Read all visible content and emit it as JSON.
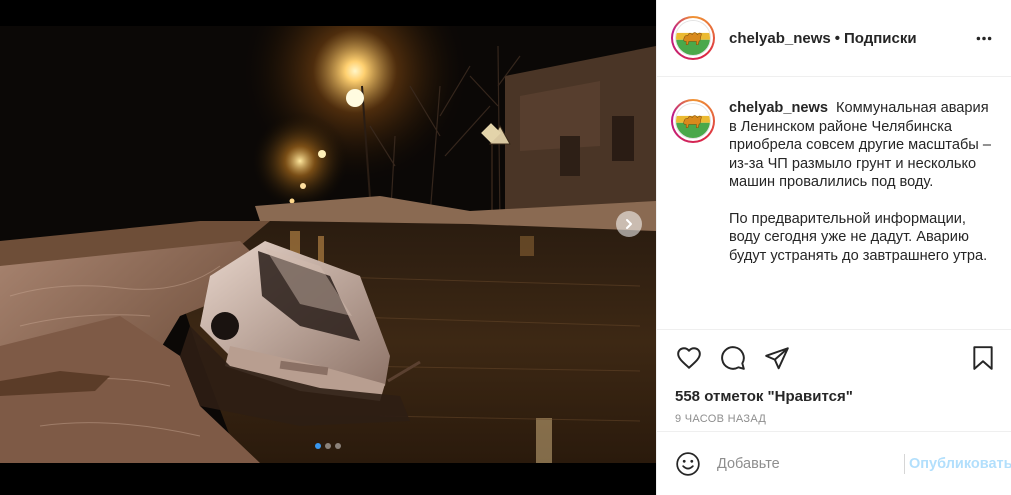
{
  "post": {
    "username": "chelyab_news",
    "separator": "•",
    "follow_label": "Подписки",
    "caption_paragraphs": [
      "Коммунальная авария в Ленинском районе Челябинска приобрела совсем другие масштабы – из-за ЧП размыло грунт и несколько машин провалились под воду.",
      "По предварительной информации, воду сегодня уже не дадут. Аварию будут устранять до завтрашнего утра."
    ],
    "likes_text": "558 отметок \"Нравится\"",
    "timestamp": "9 часов назад"
  },
  "carousel": {
    "slide_count": 3,
    "active_index": 0
  },
  "comment": {
    "placeholder": "Добавьте",
    "publish_label": "Опубликовать"
  },
  "icons": {
    "more": "more-icon",
    "like": "heart-icon",
    "comment": "comment-icon",
    "share": "share-icon",
    "save": "bookmark-icon",
    "emoji": "emoji-icon",
    "next": "chevron-right-icon"
  },
  "colors": {
    "publish_disabled": "#b2dffc",
    "active_dot": "#3897f0",
    "muted_text": "#8e8e8e"
  }
}
